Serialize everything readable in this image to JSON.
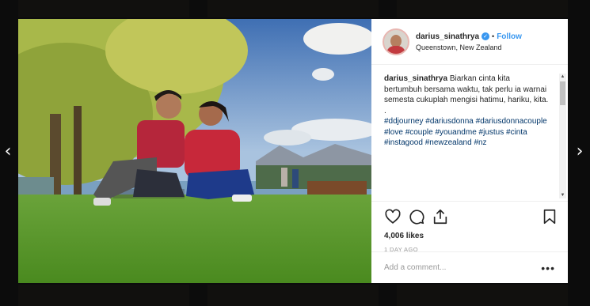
{
  "post": {
    "username": "darius_sinathrya",
    "follow_label": "Follow",
    "separator": "•",
    "location": "Queenstown, New Zealand",
    "caption_user": "darius_sinathrya",
    "caption_text": " Biarkan cinta kita bertumbuh bersama waktu, tak perlu ia warnai semesta cukuplah mengisi hatimu, hariku, kita. .",
    "hashtags": [
      "#ddjourney",
      "#dariusdonna",
      "#dariusdonnacouple",
      "#love",
      "#couple",
      "#youandme",
      "#justus",
      "#cinta",
      "#instagood",
      "#newzealand",
      "#nz"
    ],
    "likes": "4,006 likes",
    "time": "1 DAY AGO",
    "comment_placeholder": "Add a comment...",
    "more_label": "•••"
  },
  "nav": {
    "prev": "‹",
    "next": "›"
  },
  "icons": {
    "verified": "verified-badge-icon",
    "like": "heart-icon",
    "comment": "comment-icon",
    "share": "share-icon",
    "save": "bookmark-icon"
  },
  "colors": {
    "link": "#3897f0",
    "hashtag": "#003569",
    "text": "#262626",
    "muted": "#999999"
  }
}
